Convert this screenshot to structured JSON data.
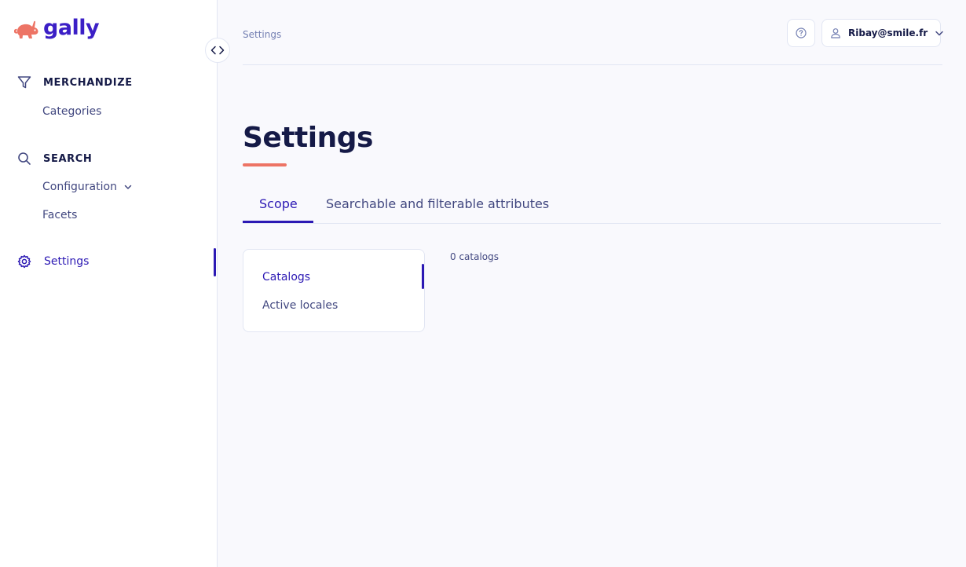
{
  "brand": {
    "name": "gally",
    "accent": "#2c19b4",
    "logo_color": "#ed7465"
  },
  "sidebar": {
    "sections": [
      {
        "title": "MERCHANDIZE",
        "icon": "funnel-icon",
        "items": [
          {
            "label": "Categories"
          }
        ]
      },
      {
        "title": "SEARCH",
        "icon": "search-icon",
        "items": [
          {
            "label": "Configuration",
            "expandable": true
          },
          {
            "label": "Facets"
          }
        ]
      }
    ],
    "settings": {
      "label": "Settings",
      "icon": "gear-icon",
      "active": true
    }
  },
  "header": {
    "breadcrumb": "Settings",
    "help_icon": "help-circle-icon",
    "user": {
      "name": "Ribay@smile.fr",
      "icon": "user-icon"
    }
  },
  "main": {
    "title": "Settings",
    "tabs": [
      {
        "label": "Scope",
        "active": true
      },
      {
        "label": "Searchable and filterable attributes",
        "active": false
      }
    ],
    "panel": {
      "items": [
        {
          "label": "Catalogs",
          "active": true
        },
        {
          "label": "Active locales",
          "active": false
        }
      ]
    },
    "catalog_count": "0 catalogs"
  }
}
